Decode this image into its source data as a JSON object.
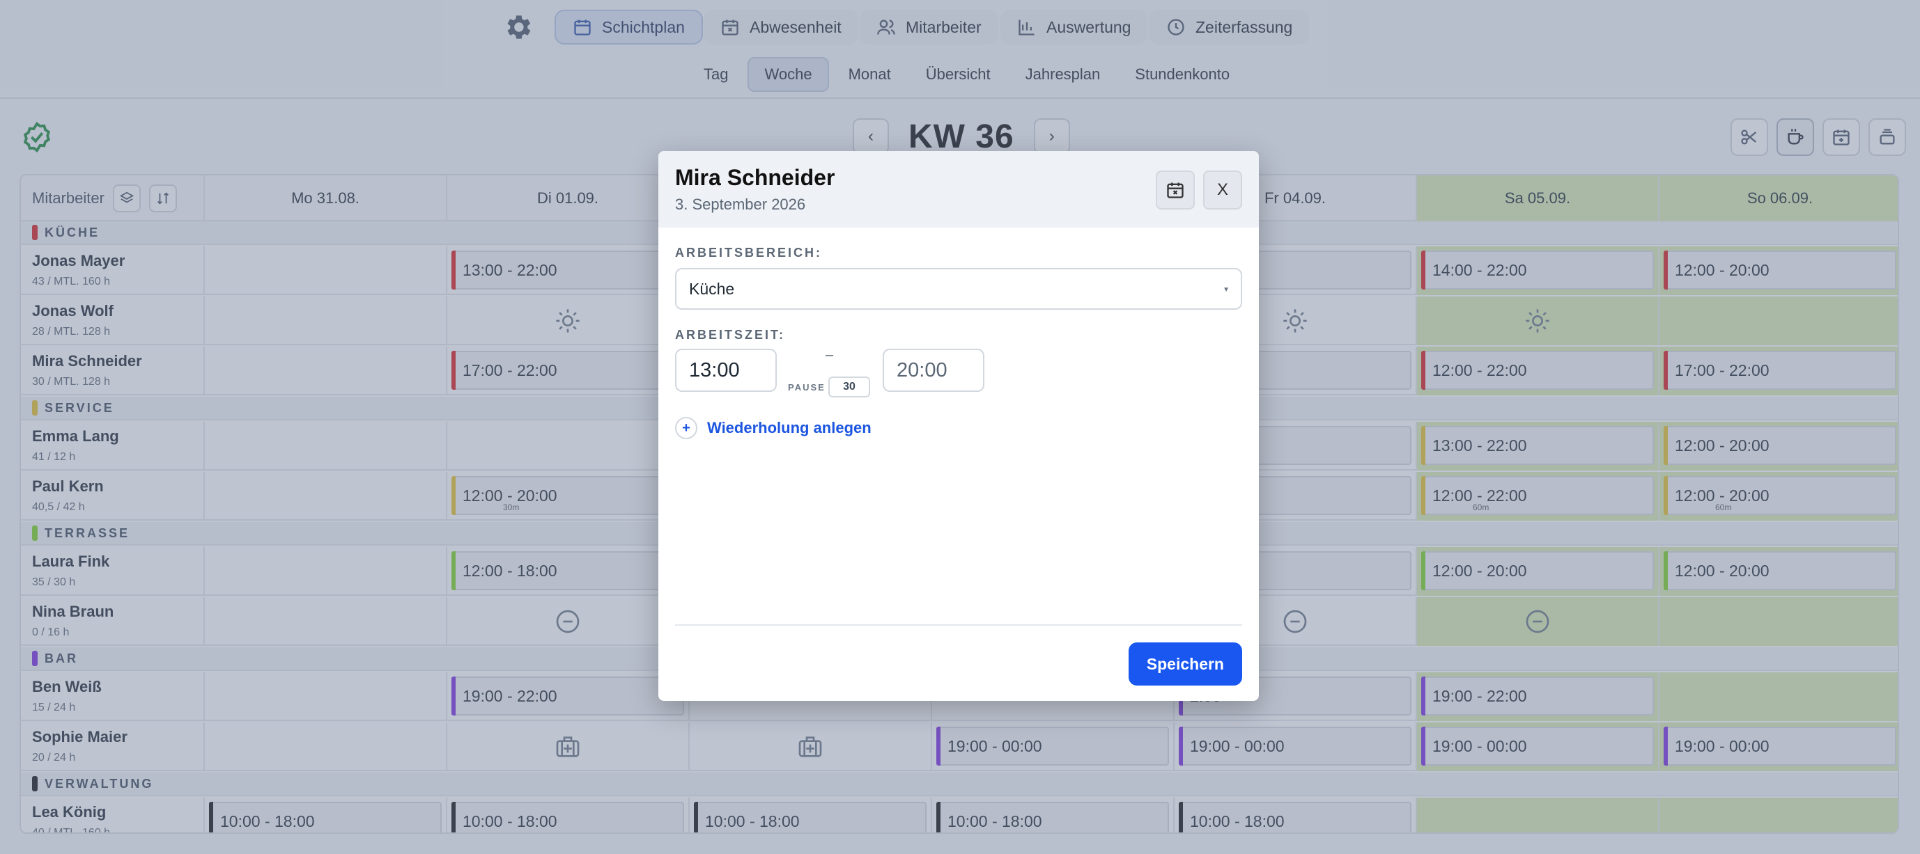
{
  "nav": {
    "settings_icon": "gear-icon",
    "tabs": [
      {
        "label": "Schichtplan",
        "icon": "calendar-icon",
        "active": true
      },
      {
        "label": "Abwesenheit",
        "icon": "calendar-x-icon",
        "active": false
      },
      {
        "label": "Mitarbeiter",
        "icon": "users-icon",
        "active": false
      },
      {
        "label": "Auswertung",
        "icon": "chart-icon",
        "active": false
      },
      {
        "label": "Zeiterfassung",
        "icon": "clock-icon",
        "active": false
      }
    ]
  },
  "subnav": {
    "tabs": [
      {
        "label": "Tag",
        "active": false
      },
      {
        "label": "Woche",
        "active": true
      },
      {
        "label": "Monat",
        "active": false
      },
      {
        "label": "Übersicht",
        "active": false
      },
      {
        "label": "Jahresplan",
        "active": false
      },
      {
        "label": "Stundenkonto",
        "active": false
      }
    ]
  },
  "week": {
    "title": "KW 36",
    "prev": "‹",
    "next": "›"
  },
  "grid": {
    "employee_header": "Mitarbeiter",
    "days": [
      {
        "label": "Mo 31.08.",
        "weekend": false
      },
      {
        "label": "Di 01.09.",
        "weekend": false
      },
      {
        "label": "Mi 02.09.",
        "weekend": false
      },
      {
        "label": "Do 03.09.",
        "weekend": false
      },
      {
        "label": "Fr 04.09.",
        "weekend": false
      },
      {
        "label": "Sa 05.09.",
        "weekend": true
      },
      {
        "label": "So 06.09.",
        "weekend": true
      }
    ],
    "sections": [
      {
        "name": "KÜCHE",
        "color": "#d91e1e",
        "rows": [
          {
            "name": "Jonas Mayer",
            "hours": "43 / MTL. 160 h",
            "cells": [
              null,
              {
                "shift": "13:00  -  22:00"
              },
              null,
              null,
              {
                "shift": "2:00"
              },
              {
                "shift": "14:00  -  22:00"
              },
              {
                "shift": "12:00  -  20:00"
              }
            ]
          },
          {
            "name": "Jonas Wolf",
            "hours": "28 / MTL. 128 h",
            "cells": [
              null,
              {
                "icon": "sun"
              },
              null,
              null,
              {
                "icon": "sun"
              },
              {
                "icon": "sun"
              },
              null
            ]
          },
          {
            "name": "Mira Schneider",
            "hours": "30 / MTL. 128 h",
            "cells": [
              null,
              {
                "shift": "17:00  -  22:00"
              },
              null,
              null,
              {
                "shift": "2:00"
              },
              {
                "shift": "12:00  -  22:00"
              },
              {
                "shift": "17:00  -  22:00"
              }
            ]
          }
        ]
      },
      {
        "name": "SERVICE",
        "color": "#e8c22a",
        "rows": [
          {
            "name": "Emma Lang",
            "hours": "41 / 12 h",
            "cells": [
              null,
              null,
              null,
              null,
              {
                "shift": "2:00"
              },
              {
                "shift": "13:00  -  22:00"
              },
              {
                "shift": "12:00  -  20:00"
              }
            ]
          },
          {
            "name": "Paul Kern",
            "hours": "40,5 / 42 h",
            "cells": [
              null,
              {
                "shift": "12:00  -  20:00",
                "pause": "30m"
              },
              null,
              null,
              {
                "shift": "2:00"
              },
              {
                "shift": "12:00  -  22:00",
                "pause": "60m"
              },
              {
                "shift": "12:00  -  20:00",
                "pause": "60m"
              }
            ]
          }
        ]
      },
      {
        "name": "TERRASSE",
        "color": "#7ed321",
        "rows": [
          {
            "name": "Laura Fink",
            "hours": "35 / 30 h",
            "cells": [
              null,
              {
                "shift": "12:00  -  18:00"
              },
              null,
              null,
              {
                "shift": "2:00"
              },
              {
                "shift": "12:00  -  20:00"
              },
              {
                "shift": "12:00  -  20:00"
              }
            ]
          },
          {
            "name": "Nina Braun",
            "hours": "0 / 16 h",
            "cells": [
              null,
              {
                "icon": "minus"
              },
              null,
              null,
              {
                "icon": "minus"
              },
              {
                "icon": "minus"
              },
              null
            ]
          }
        ]
      },
      {
        "name": "BAR",
        "color": "#7b2fe0",
        "rows": [
          {
            "name": "Ben Weiß",
            "hours": "15 / 24 h",
            "cells": [
              null,
              {
                "shift": "19:00  -  22:00"
              },
              null,
              null,
              {
                "shift": "2:00"
              },
              {
                "shift": "19:00  -  22:00"
              },
              null
            ]
          },
          {
            "name": "Sophie Maier",
            "hours": "20 / 24 h",
            "cells": [
              null,
              {
                "icon": "medkit"
              },
              {
                "icon": "medkit"
              },
              {
                "shift": "19:00  -  00:00"
              },
              {
                "shift": "19:00  -  00:00"
              },
              {
                "shift": "19:00  -  00:00"
              },
              {
                "shift": "19:00  -  00:00"
              }
            ]
          }
        ]
      },
      {
        "name": "VERWALTUNG",
        "color": "#111111",
        "rows": [
          {
            "name": "Lea König",
            "hours": "40 / MTL. 160 h",
            "cells": [
              {
                "shift": "10:00  -  18:00"
              },
              {
                "shift": "10:00  -  18:00"
              },
              {
                "shift": "10:00  -  18:00"
              },
              {
                "shift": "10:00  -  18:00"
              },
              {
                "shift": "10:00  -  18:00"
              },
              null,
              null
            ]
          }
        ]
      }
    ]
  },
  "modal": {
    "title": "Mira Schneider",
    "date": "3. September 2026",
    "close_label": "X",
    "area_label": "ARBEITSBEREICH:",
    "area_value": "Küche",
    "time_label": "ARBEITSZEIT:",
    "start": "13:00",
    "end": "20:00",
    "dash": "–",
    "pause_label": "PAUSE",
    "pause_value": "30",
    "repeat_label": "Wiederholung anlegen",
    "save_label": "Speichern"
  }
}
